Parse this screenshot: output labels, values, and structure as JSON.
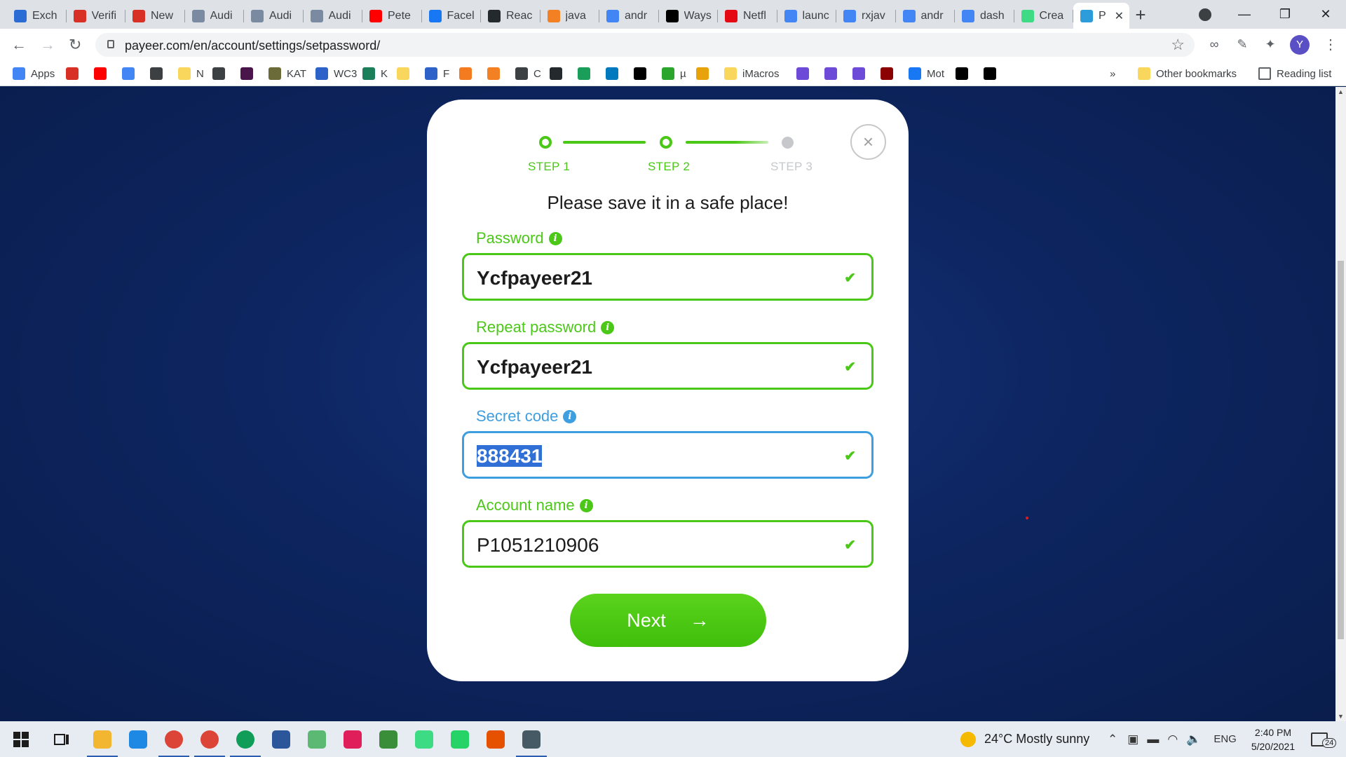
{
  "browser": {
    "tabs": [
      {
        "title": "Exch",
        "icon": "x-icon",
        "color": "#2b6cd4"
      },
      {
        "title": "Verifi",
        "icon": "gmail-icon",
        "color": "#d93025"
      },
      {
        "title": "New",
        "icon": "gmail-icon",
        "color": "#d93025"
      },
      {
        "title": "Audi",
        "icon": "audit-icon",
        "color": "#7a8aa0"
      },
      {
        "title": "Audi",
        "icon": "audit-icon",
        "color": "#7a8aa0"
      },
      {
        "title": "Audi",
        "icon": "audit-icon",
        "color": "#7a8aa0"
      },
      {
        "title": "Pete",
        "icon": "youtube-icon",
        "color": "#ff0000"
      },
      {
        "title": "Facel",
        "icon": "facebook-icon",
        "color": "#1877f2"
      },
      {
        "title": "Reac",
        "icon": "github-icon",
        "color": "#24292e"
      },
      {
        "title": "java",
        "icon": "stackoverflow-icon",
        "color": "#f48024"
      },
      {
        "title": "andr",
        "icon": "google-icon",
        "color": "#4285f4"
      },
      {
        "title": "Ways",
        "icon": "medium-icon",
        "color": "#000000"
      },
      {
        "title": "Netfl",
        "icon": "netflix-icon",
        "color": "#e50914"
      },
      {
        "title": "launc",
        "icon": "google-icon",
        "color": "#4285f4"
      },
      {
        "title": "rxjav",
        "icon": "google-icon",
        "color": "#4285f4"
      },
      {
        "title": "andr",
        "icon": "google-icon",
        "color": "#4285f4"
      },
      {
        "title": "dash",
        "icon": "google-icon",
        "color": "#4285f4"
      },
      {
        "title": "Crea",
        "icon": "android-icon",
        "color": "#3ddc84"
      },
      {
        "title": "P",
        "icon": "payeer-icon",
        "color": "#2d9cdb",
        "active": true
      }
    ],
    "url": "payeer.com/en/account/settings/setpassword/",
    "profile_initial": "Y",
    "bookmarks": [
      {
        "label": "Apps",
        "icon": "apps-icon",
        "color": "#4285f4"
      },
      {
        "label": "",
        "icon": "gmail-icon",
        "color": "#d93025"
      },
      {
        "label": "",
        "icon": "youtube-icon",
        "color": "#ff0000"
      },
      {
        "label": "",
        "icon": "translate-icon",
        "color": "#4285f4"
      },
      {
        "label": "",
        "icon": "vscode-icon",
        "color": "#3c4043"
      },
      {
        "label": "N",
        "icon": "folder-icon",
        "color": "#f9d65c"
      },
      {
        "label": "",
        "icon": "flag-icon",
        "color": "#3c4043"
      },
      {
        "label": "",
        "icon": "slack-icon",
        "color": "#4a154b"
      },
      {
        "label": "KAT",
        "icon": "kat-icon",
        "color": "#6b6b3a"
      },
      {
        "label": "WC3",
        "icon": "w3schools-icon",
        "color": "#2d63c8"
      },
      {
        "label": "K",
        "icon": "k-icon",
        "color": "#1a7f5a"
      },
      {
        "label": "",
        "icon": "folder-icon",
        "color": "#f9d65c"
      },
      {
        "label": "F",
        "icon": "form-icon",
        "color": "#2d63c8"
      },
      {
        "label": "",
        "icon": "code-icon",
        "color": "#f47b20"
      },
      {
        "label": "",
        "icon": "stackoverflow-icon",
        "color": "#f48024"
      },
      {
        "label": "C",
        "icon": "flag-icon",
        "color": "#3c4043"
      },
      {
        "label": "",
        "icon": "github-icon",
        "color": "#24292e"
      },
      {
        "label": "",
        "icon": "shield-icon",
        "color": "#1a9e5a"
      },
      {
        "label": "",
        "icon": "trello-icon",
        "color": "#0079bf"
      },
      {
        "label": "",
        "icon": "yt-icon",
        "color": "#000000"
      },
      {
        "label": "µ",
        "icon": "utorrent-icon",
        "color": "#2ca52c"
      },
      {
        "label": "",
        "icon": "pna-icon",
        "color": "#e8a20c"
      },
      {
        "label": "iMacros",
        "icon": "folder-icon",
        "color": "#f9d65c"
      },
      {
        "label": "",
        "icon": "upwork-icon",
        "color": "#6d4bd8"
      },
      {
        "label": "",
        "icon": "upwork-icon",
        "color": "#6d4bd8"
      },
      {
        "label": "",
        "icon": "upwork-icon",
        "color": "#6d4bd8"
      },
      {
        "label": "",
        "icon": "record-icon",
        "color": "#8b0000"
      },
      {
        "label": "Mot",
        "icon": "facebook-icon",
        "color": "#1877f2"
      },
      {
        "label": "",
        "icon": "medium-icon",
        "color": "#000000"
      },
      {
        "label": "",
        "icon": "medium-icon",
        "color": "#000000"
      }
    ],
    "more_bookmarks": "»",
    "other_bookmarks": "Other bookmarks",
    "reading_list": "Reading list"
  },
  "dialog": {
    "steps": [
      {
        "label": "STEP 1",
        "state": "done"
      },
      {
        "label": "STEP 2",
        "state": "done"
      },
      {
        "label": "STEP 3",
        "state": "todo"
      }
    ],
    "headline": "Please save it in a safe place!",
    "fields": [
      {
        "label": "Password",
        "value": "Ycfpayeer21"
      },
      {
        "label": "Repeat password",
        "value": "Ycfpayeer21"
      },
      {
        "label": "Secret code",
        "value": "888431",
        "focused": true,
        "selected": true
      },
      {
        "label": "Account name",
        "value": "P1051210906"
      }
    ],
    "next_label": "Next",
    "close_symbol": "×"
  },
  "colors": {
    "accent_green": "#4bc817",
    "focus_blue": "#3d9ee0",
    "page_background": "#0b2454"
  },
  "taskbar": {
    "apps": [
      {
        "icon": "start-icon"
      },
      {
        "icon": "task-view-icon"
      },
      {
        "icon": "file-explorer-icon",
        "color": "#f2b630",
        "active": true
      },
      {
        "icon": "launcher-l-icon",
        "color": "#1e88e5"
      },
      {
        "icon": "chrome-icon",
        "color": "#db4437",
        "active": true
      },
      {
        "icon": "chrome-icon",
        "color": "#db4437",
        "active": true
      },
      {
        "icon": "chrome-icon",
        "color": "#0f9d58",
        "active": true
      },
      {
        "icon": "word-icon",
        "color": "#2b579a"
      },
      {
        "icon": "timer-icon",
        "color": "#5bb974"
      },
      {
        "icon": "slack-icon",
        "color": "#e01e5a"
      },
      {
        "icon": "editor-icon",
        "color": "#3a8e3a"
      },
      {
        "icon": "android-studio-icon",
        "color": "#3ddc84"
      },
      {
        "icon": "whatsapp-icon",
        "color": "#25d366"
      },
      {
        "icon": "tunnel-icon",
        "color": "#e65100"
      },
      {
        "icon": "calculator-icon",
        "color": "#455a64",
        "active": true
      }
    ],
    "weather": "24°C  Mostly sunny",
    "language": "ENG",
    "time": "2:40 PM",
    "date": "5/20/2021",
    "notifications": "24"
  }
}
